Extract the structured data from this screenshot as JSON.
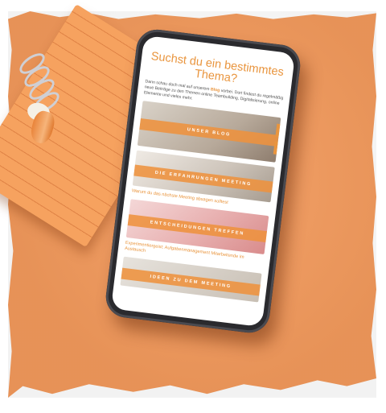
{
  "screen": {
    "title": "Suchst du ein bestimmtes Thema?",
    "intro_before": "Dann schau doch mal auf unserem ",
    "intro_link": "Blog",
    "intro_after": " vorbei. Dort findest du regelmäßig neue Beiträge zu den Themen online Teambuilding, Digitalisierung, online Elemente und vieles mehr.",
    "cards": [
      {
        "band": "Unser Blog",
        "caption": ""
      },
      {
        "band": "Die Erfahrungen Meeting",
        "caption": "Warum du das nächste Meeting absagen solltest"
      },
      {
        "band": "Entscheidungen treffen",
        "caption": "Experimentiergeist: Aufgabenmanagement Mitarbeitende im Austausch"
      },
      {
        "band": "Ideen zu dem Meeting",
        "caption": ""
      }
    ]
  },
  "colors": {
    "background": "#f39a5c",
    "accent": "#e9953e",
    "phone_frame": "#2a2a2e"
  }
}
